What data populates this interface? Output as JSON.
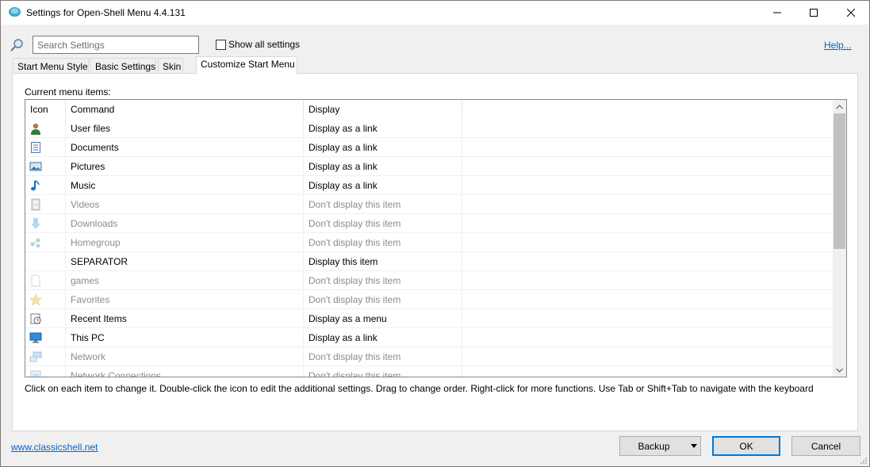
{
  "window": {
    "title": "Settings for Open-Shell Menu 4.4.131"
  },
  "search": {
    "placeholder": "Search Settings",
    "value": ""
  },
  "show_all": {
    "label": "Show all settings",
    "checked": false
  },
  "help": {
    "label": "Help..."
  },
  "tabs": [
    {
      "label": "Start Menu Style",
      "active": false
    },
    {
      "label": "Basic Settings",
      "active": false
    },
    {
      "label": "Skin",
      "active": false
    },
    {
      "label": "Customize Start Menu",
      "active": true
    }
  ],
  "panel": {
    "current_label": "Current menu items:",
    "columns": [
      "Icon",
      "Command",
      "Display"
    ],
    "rows": [
      {
        "icon": "user-icon",
        "command": "User files",
        "display": "Display as a link",
        "enabled": true
      },
      {
        "icon": "document-icon",
        "command": "Documents",
        "display": "Display as a link",
        "enabled": true
      },
      {
        "icon": "picture-icon",
        "command": "Pictures",
        "display": "Display as a link",
        "enabled": true
      },
      {
        "icon": "music-note-icon",
        "command": "Music",
        "display": "Display as a link",
        "enabled": true
      },
      {
        "icon": "film-icon",
        "command": "Videos",
        "display": "Don't display this item",
        "enabled": false
      },
      {
        "icon": "download-arrow-icon",
        "command": "Downloads",
        "display": "Don't display this item",
        "enabled": false
      },
      {
        "icon": "homegroup-icon",
        "command": "Homegroup",
        "display": "Don't display this item",
        "enabled": false
      },
      {
        "icon": "",
        "command": "SEPARATOR",
        "display": "Display this item",
        "enabled": true
      },
      {
        "icon": "blank-page-icon",
        "command": "games",
        "display": "Don't display this item",
        "enabled": false
      },
      {
        "icon": "star-icon",
        "command": "Favorites",
        "display": "Don't display this item",
        "enabled": false
      },
      {
        "icon": "recent-items-icon",
        "command": "Recent Items",
        "display": "Display as a menu",
        "enabled": true
      },
      {
        "icon": "monitor-icon",
        "command": "This PC",
        "display": "Display as a link",
        "enabled": true
      },
      {
        "icon": "network-icon",
        "command": "Network",
        "display": "Don't display this item",
        "enabled": false
      },
      {
        "icon": "network-connections-icon",
        "command": "Network Connections",
        "display": "Don't display this item",
        "enabled": false
      }
    ],
    "hint": "Click on each item to change it. Double-click the icon to edit the additional settings. Drag to change order. Right-click for more functions. Use Tab or Shift+Tab to navigate with the keyboard"
  },
  "footer": {
    "link": "www.classicshell.net",
    "backup_label": "Backup",
    "ok_label": "OK",
    "cancel_label": "Cancel"
  },
  "colors": {
    "accent": "#0078d7",
    "link": "#0066cc",
    "dim_text": "#8c8c8c"
  }
}
